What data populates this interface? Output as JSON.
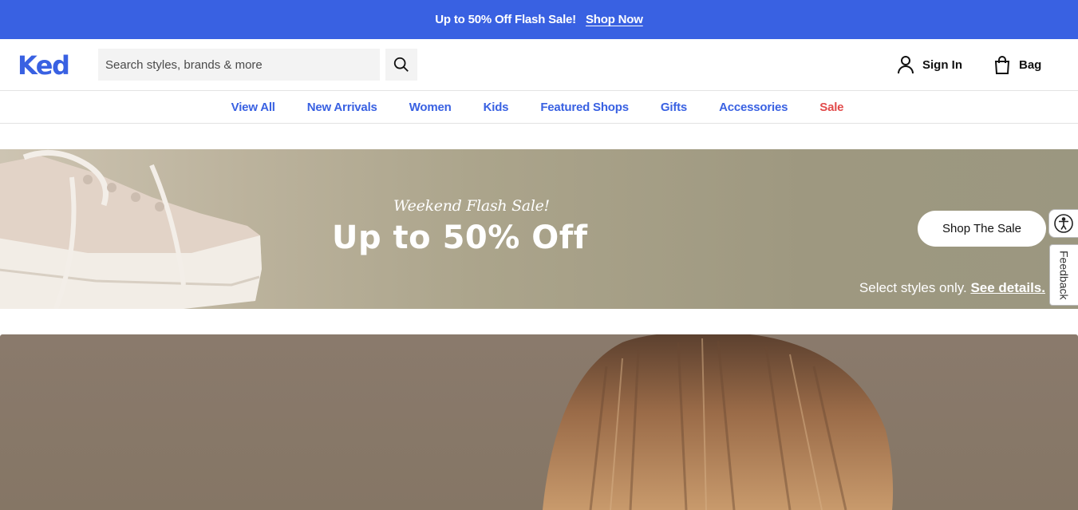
{
  "promo": {
    "text": "Up to 50% Off Flash Sale!",
    "link": "Shop Now"
  },
  "header": {
    "logo": "Ked",
    "search_placeholder": "Search styles, brands & more",
    "sign_in": "Sign In",
    "bag": "Bag"
  },
  "nav": {
    "items": [
      "View All",
      "New Arrivals",
      "Women",
      "Kids",
      "Featured Shops",
      "Gifts",
      "Accessories",
      "Sale"
    ]
  },
  "hero": {
    "eyebrow": "Weekend Flash Sale!",
    "title": "Up to 50% Off",
    "cta": "Shop The Sale",
    "note": "Select styles only.",
    "note_link": "See details."
  },
  "widgets": {
    "feedback": "Feedback"
  },
  "colors": {
    "brand": "#3961e2",
    "sale": "#e24b4b",
    "hero_bg": "#a59f87"
  }
}
